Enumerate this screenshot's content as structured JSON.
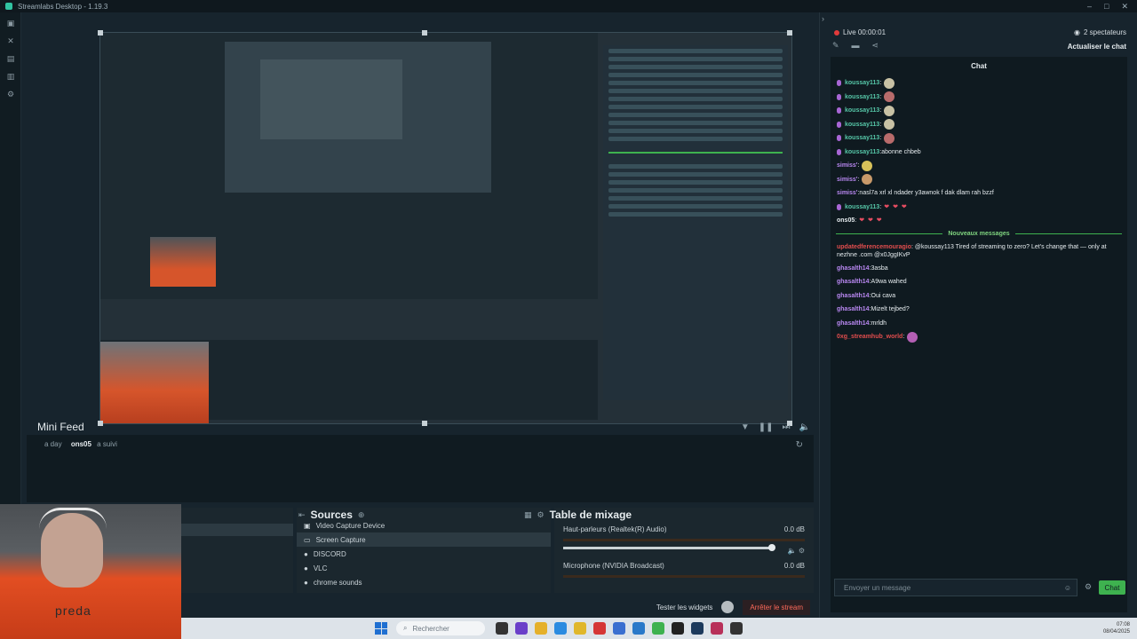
{
  "window": {
    "title": "Streamlabs Desktop - 1.19.3",
    "controls": [
      "–",
      "□",
      "✕"
    ]
  },
  "nav": {
    "icons": [
      "studio-icon",
      "tools-icon",
      "store-icon",
      "library-icon",
      "settings-icon"
    ]
  },
  "minifeed": {
    "title": "Mini Feed",
    "events": [
      {
        "time": "a day",
        "user": "ons05",
        "action": "a suivi"
      }
    ]
  },
  "sources": {
    "title": "Sources",
    "items": [
      {
        "label": "Video Capture Device",
        "icon": "camera-icon",
        "selected": false
      },
      {
        "label": "Screen Capture",
        "icon": "monitor-icon",
        "selected": true
      },
      {
        "label": "DISCORD",
        "icon": "person-icon",
        "selected": false
      },
      {
        "label": "VLC",
        "icon": "person-icon",
        "selected": false
      },
      {
        "label": "chrome sounds",
        "icon": "person-icon",
        "selected": false
      }
    ]
  },
  "mixer": {
    "title": "Table de mixage",
    "channels": [
      {
        "name": "Haut-parleurs (Realtek(R) Audio)",
        "db": "0.0 dB",
        "level": 1.0
      },
      {
        "name": "Microphone (NVIDIA Broadcast)",
        "db": "0.0 dB",
        "level": 1.0
      }
    ]
  },
  "controls": {
    "test_widgets": "Tester les widgets",
    "stop_stream": "Arrêter le stream"
  },
  "webcam": {
    "brand": "preda"
  },
  "taskbar": {
    "search_placeholder": "Rechercher",
    "time": "07:08",
    "date": "08/04/2025"
  },
  "chat": {
    "status": "Live 00:00:01",
    "viewers": "2 spectateurs",
    "refresh": "Actualiser le chat",
    "title": "Chat",
    "messages": [
      {
        "user": "koussay113",
        "text": "",
        "mic": true,
        "color": "teal",
        "emote": "#c8c1a4"
      },
      {
        "user": "koussay113",
        "text": "",
        "mic": true,
        "color": "teal",
        "emote": "#b86b6b"
      },
      {
        "user": "koussay113",
        "text": "",
        "mic": true,
        "color": "teal",
        "emote": "#c8c1a4"
      },
      {
        "user": "koussay113",
        "text": "",
        "mic": true,
        "color": "teal",
        "emote": "#c8c1a4"
      },
      {
        "user": "koussay113",
        "text": "",
        "mic": true,
        "color": "teal",
        "emote": "#b86b6b"
      },
      {
        "user": "koussay113",
        "text": "abonne chbeb",
        "mic": true,
        "color": "teal",
        "emote": ""
      },
      {
        "user": "simiss'",
        "text": "",
        "mic": false,
        "color": "purple",
        "emote": "#d8c25a"
      },
      {
        "user": "simiss'",
        "text": "",
        "mic": false,
        "color": "purple",
        "emote": "#c99a6a"
      },
      {
        "user": "simiss'",
        "text": "nasl7a xrl xl ndader y3awnok f dak dlam rah bzzf",
        "mic": false,
        "color": "purple",
        "emote": ""
      },
      {
        "user": "koussay113",
        "text": "",
        "mic": true,
        "color": "teal",
        "hearts": "❤ ❤ ❤"
      },
      {
        "user": "ons05",
        "text": "",
        "mic": false,
        "color": "white",
        "hearts": "❤ ❤ ❤"
      }
    ],
    "divider": "Nouveaux messages",
    "new_messages": [
      {
        "user": "updatedferencemouragio",
        "text": "@koussay113 Tired of streaming to zero? Let's change that — only at nezhne .com @x0JggIKvP",
        "color": "red",
        "wrap": true
      },
      {
        "user": "ghasalth14",
        "text": "3asba",
        "color": "purple"
      },
      {
        "user": "ghasalth14",
        "text": "A9wa wahed",
        "color": "purple"
      },
      {
        "user": "ghasalth14",
        "text": "Oui cava",
        "color": "purple"
      },
      {
        "user": "ghasalth14",
        "text": "Mizelt tejbed?",
        "color": "purple"
      },
      {
        "user": "ghasalth14",
        "text": "mrldh",
        "color": "purple"
      },
      {
        "user": "0xg_streamhub_world",
        "text": "",
        "color": "red",
        "emote": "#b45fb4"
      }
    ],
    "input_placeholder": "Envoyer un message",
    "send_label": "Chat"
  }
}
